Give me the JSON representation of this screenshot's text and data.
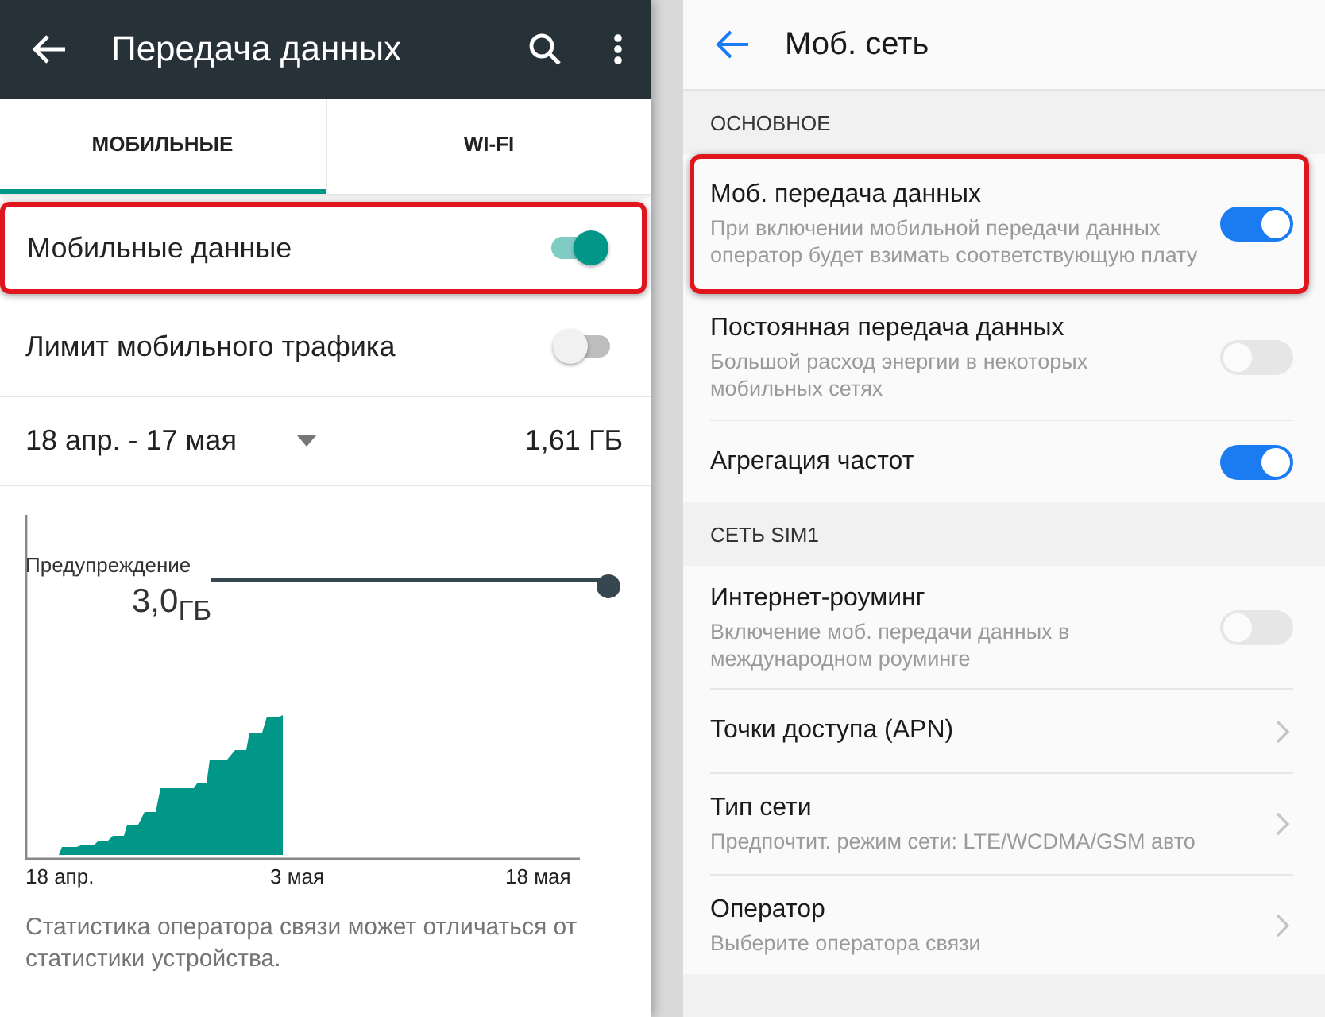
{
  "left_screen": {
    "title": "Передача данных",
    "tabs": [
      {
        "label": "МОБИЛЬНЫЕ",
        "selected": true
      },
      {
        "label": "WI-FI",
        "selected": false
      }
    ],
    "settings": [
      {
        "label": "Мобильные данные",
        "on": true,
        "highlighted": true
      },
      {
        "label": "Лимит мобильного трафика",
        "on": false,
        "highlighted": false
      }
    ],
    "period": {
      "range": "18 апр. - 17 мая",
      "usage": "1,61 ГБ"
    },
    "usage_chart": {
      "warning_label": "Предупреждение",
      "warning_value": "3,0$_{ГБ}$",
      "x_labels": [
        "18 апр.",
        "3 мая",
        "18 мая"
      ]
    },
    "note": "Статистика оператора связи может отличаться от статистики устройства."
  },
  "right_screen": {
    "title": "Моб. сеть",
    "sections": [
      {
        "header": "ОСНОВНОЕ",
        "items": [
          {
            "kind": "switch",
            "title": "Моб. передача данных",
            "subtitle": "При включении мобильной передачи данных оператор будет взимать соответствующую плату",
            "on": true,
            "highlighted": true
          },
          {
            "kind": "switch",
            "title": "Постоянная передача данных",
            "subtitle": "Большой расход энергии в некоторых мобильных сетях",
            "on": false,
            "highlighted": false
          },
          {
            "kind": "switch",
            "title": "Агрегация частот",
            "on": true,
            "highlighted": false
          }
        ]
      },
      {
        "header": "СЕТЬ SIM1",
        "items": [
          {
            "kind": "switch",
            "title": "Интернет-роуминг",
            "subtitle": "Включение моб. передачи данных в международном роуминге",
            "on": false,
            "highlighted": false
          },
          {
            "kind": "link",
            "title": "Точки доступа (APN)",
            "highlighted": false
          },
          {
            "kind": "link",
            "title": "Тип сети",
            "subtitle": "Предпочтит. режим сети: LTE/WCDMA/GSM авто",
            "highlighted": false
          },
          {
            "kind": "link",
            "title": "Оператор",
            "subtitle": "Выберите оператора связи",
            "highlighted": false
          }
        ]
      }
    ]
  }
}
